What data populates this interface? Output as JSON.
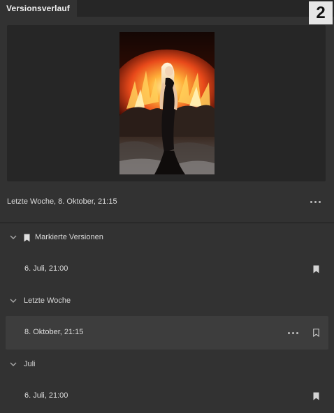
{
  "panel": {
    "tab_label": "Versionsverlauf",
    "step_badge": "2",
    "menu_icon": "hamburger-menu-icon"
  },
  "preview": {
    "image": "fantasy artwork: blonde woman in black dress before flames and dark rocks"
  },
  "current_version": {
    "label": "Letzte Woche, 8. Oktober, 21:15",
    "more_icon": "more-horizontal-icon"
  },
  "groups": [
    {
      "label": "Markierte Versionen",
      "icon": "bookmark-icon",
      "items": [
        {
          "label": "6. Juli, 21:00",
          "bookmarked": true,
          "selected": false
        }
      ]
    },
    {
      "label": "Letzte Woche",
      "items": [
        {
          "label": "8. Oktober, 21:15",
          "bookmarked": false,
          "selected": true
        }
      ]
    },
    {
      "label": "Juli",
      "items": [
        {
          "label": "6. Juli, 21:00",
          "bookmarked": true,
          "selected": false
        }
      ]
    }
  ],
  "colors": {
    "panel_bg": "#323232",
    "preview_bg": "#262626",
    "selected_row_bg": "#3d3d3d",
    "text": "#e6e6e6"
  }
}
